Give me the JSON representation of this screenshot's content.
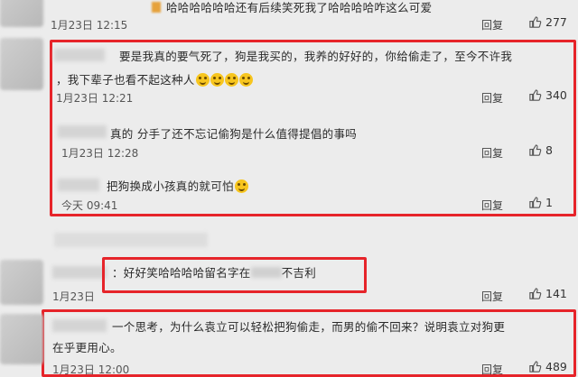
{
  "comments": [
    {
      "text": "哈哈哈哈哈哈还有后续笑死我了哈哈哈哈咋这么可爱",
      "time": "1月23日 12:15",
      "reply_label": "回复",
      "likes": "277"
    },
    {
      "text_line1": "要是我真的要气死了，狗是我买的，我养的好好的，你给偷走了，至今不许我",
      "text_line2": "，我下辈子也看不起这种人",
      "time": "1月23日 12:21",
      "reply_label": "回复",
      "likes": "340"
    },
    {
      "text": "真的 分手了还不忘记偷狗是什么值得提倡的事吗",
      "time": "1月23日 12:28",
      "reply_label": "回复",
      "likes": "8"
    },
    {
      "text": "把狗换成小孩真的就可怕",
      "time": "今天 09:41",
      "reply_label": "回复",
      "likes": "1"
    },
    {
      "text_before": "：好好笑哈哈哈哈留名字在",
      "text_after": "不吉利",
      "time": "1月23日",
      "reply_label": "回复",
      "likes": "141"
    },
    {
      "text_line1": "一个思考，为什么袁立可以轻松把狗偷走，而男的偷不回来？说明袁立对狗更",
      "text_line2": "在乎更用心。",
      "time": "1月23日 12:00",
      "reply_label": "回复",
      "likes": "489"
    }
  ],
  "colors": {
    "highlight_border": "#e6242a"
  }
}
